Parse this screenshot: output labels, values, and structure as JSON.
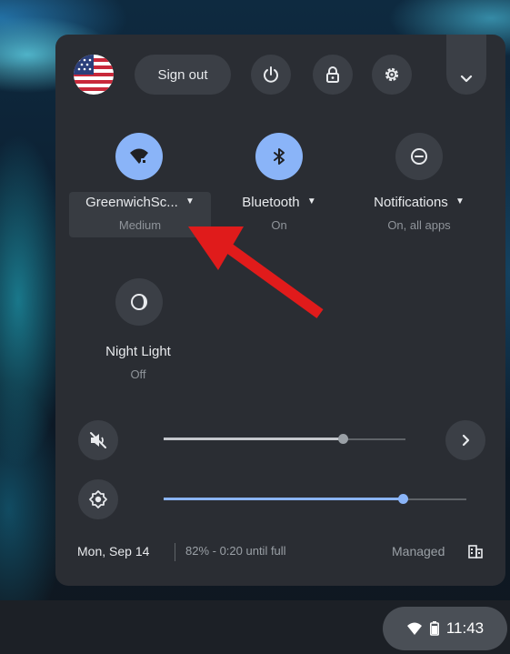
{
  "toolbar": {
    "sign_out_label": "Sign out"
  },
  "features": {
    "network": {
      "label": "GreenwichSc...",
      "status": "Medium"
    },
    "bluetooth": {
      "label": "Bluetooth",
      "status": "On"
    },
    "notifications": {
      "label": "Notifications",
      "status": "On, all apps"
    },
    "night_light": {
      "label": "Night Light",
      "status": "Off"
    }
  },
  "sliders": {
    "volume_level": 0.74,
    "volume_muted": true,
    "brightness_level": 0.79
  },
  "footer": {
    "date": "Mon, Sep 14",
    "battery": "82% - 0:20 until full",
    "managed": "Managed"
  },
  "tray": {
    "time": "11:43"
  },
  "colors": {
    "accent": "#8ab4f8",
    "panel": "#2a2d33",
    "annotation_arrow": "#e01b1b"
  },
  "icons": [
    "avatar-flag",
    "power-icon",
    "lock-icon",
    "gear-icon",
    "chevron-down-icon",
    "wifi-icon",
    "bluetooth-icon",
    "notifications-icon",
    "night-light-icon",
    "volume-muted-icon",
    "chevron-right-icon",
    "brightness-icon",
    "managed-icon",
    "battery-icon"
  ]
}
